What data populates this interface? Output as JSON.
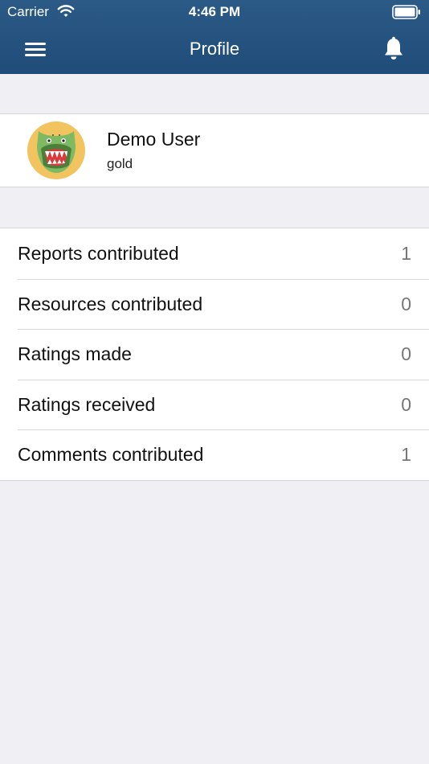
{
  "status_bar": {
    "carrier": "Carrier",
    "time": "4:46 PM",
    "wifi_icon": "wifi-icon",
    "battery_icon": "battery-icon"
  },
  "nav": {
    "title": "Profile",
    "menu_icon": "hamburger-menu-icon",
    "bell_icon": "bell-icon",
    "background_color": "#24527f"
  },
  "profile": {
    "name": "Demo User",
    "level": "gold",
    "avatar_icon": "crocodile-avatar-icon",
    "avatar_bg_color": "#f2c45f"
  },
  "stats": [
    {
      "label": "Reports contributed",
      "value": "1"
    },
    {
      "label": "Resources contributed",
      "value": "0"
    },
    {
      "label": "Ratings made",
      "value": "0"
    },
    {
      "label": "Ratings received",
      "value": "0"
    },
    {
      "label": "Comments contributed",
      "value": "1"
    }
  ]
}
